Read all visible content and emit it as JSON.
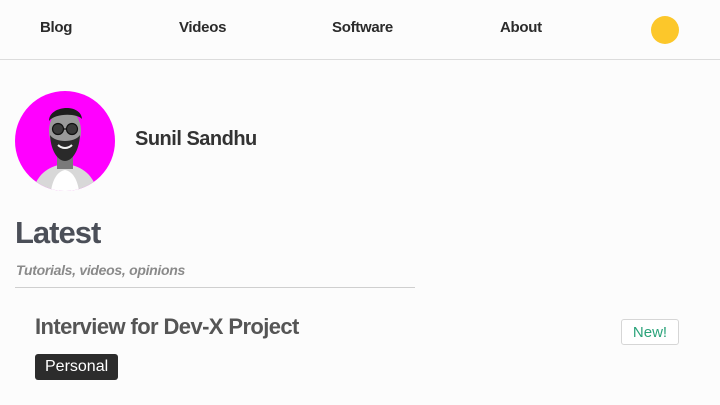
{
  "nav": {
    "blog": "Blog",
    "videos": "Videos",
    "software": "Software",
    "about": "About"
  },
  "colors": {
    "theme_toggle": "#fcc72a",
    "avatar_bg": "#ff00ff",
    "new_badge_text": "#2aa37a"
  },
  "profile": {
    "name": "Sunil Sandhu"
  },
  "section": {
    "title": "Latest",
    "subtitle": "Tutorials, videos, opinions"
  },
  "post": {
    "title": "Interview for Dev-X Project",
    "badge": "New!",
    "tag": "Personal"
  }
}
